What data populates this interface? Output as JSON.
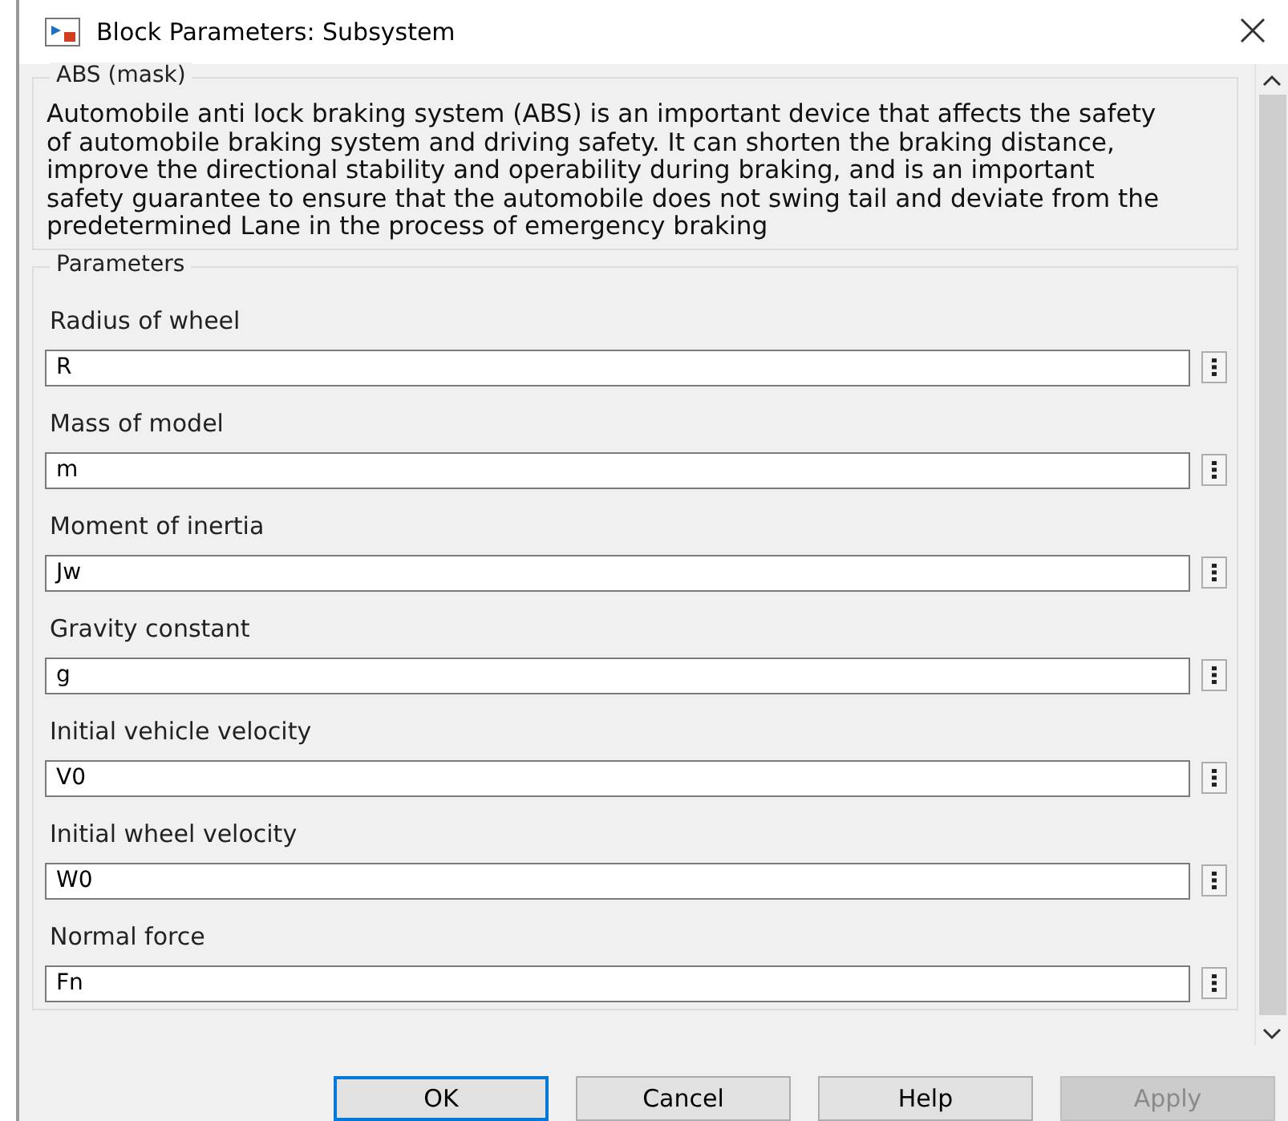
{
  "window": {
    "title": "Block Parameters: Subsystem"
  },
  "mask": {
    "title": "ABS  (mask)",
    "description": "Automobile anti lock braking system (ABS) is an important device that affects the safety of automobile braking system and driving safety. It can shorten the braking distance, improve the directional stability and operability during braking, and is an important safety guarantee to ensure that the automobile does not swing tail and deviate from the predetermined Lane in the process of emergency braking"
  },
  "parameters": {
    "title": "Parameters",
    "items": [
      {
        "label": "Radius of wheel",
        "value": "R"
      },
      {
        "label": "Mass of model",
        "value": "m"
      },
      {
        "label": "Moment of inertia",
        "value": "Jw"
      },
      {
        "label": "Gravity constant",
        "value": "g"
      },
      {
        "label": "Initial vehicle velocity",
        "value": "V0"
      },
      {
        "label": "Initial wheel velocity",
        "value": "W0"
      },
      {
        "label": "Normal  force",
        "value": "Fn"
      }
    ]
  },
  "buttons": [
    {
      "label": "OK",
      "disabled": false,
      "default": true
    },
    {
      "label": "Cancel",
      "disabled": false,
      "default": false
    },
    {
      "label": "Help",
      "disabled": false,
      "default": false
    },
    {
      "label": "Apply",
      "disabled": true,
      "default": false
    }
  ]
}
